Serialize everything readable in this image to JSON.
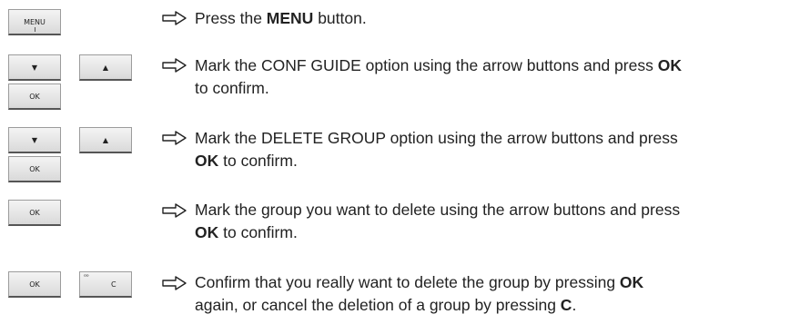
{
  "keys": {
    "menu": "MENU",
    "down": "▼",
    "up": "▲",
    "ok": "OK",
    "c": "C",
    "c_small": "ᵅᵒ"
  },
  "steps": [
    {
      "pre": "Press the ",
      "bold": "MENU",
      "post": " button.",
      "line2": ""
    },
    {
      "pre": "Mark the CONF GUIDE option using the arrow buttons and press ",
      "bold": "OK",
      "post": "",
      "line2_bold": "",
      "line2": "to confirm."
    },
    {
      "pre": "Mark the DELETE GROUP option using the arrow buttons and press",
      "bold": "",
      "post": "",
      "line2_bold": "OK",
      "line2": " to confirm."
    },
    {
      "pre": "Mark the group you want to delete using the arrow buttons and press",
      "bold": "",
      "post": "",
      "line2_bold": "OK",
      "line2": " to confirm."
    },
    {
      "pre": "Confirm that you really want to delete the group by pressing ",
      "bold": "OK",
      "post": "",
      "line2_pre": "again, or cancel the deletion of a group by pressing ",
      "line2_bold": "C",
      "line2": "."
    }
  ]
}
